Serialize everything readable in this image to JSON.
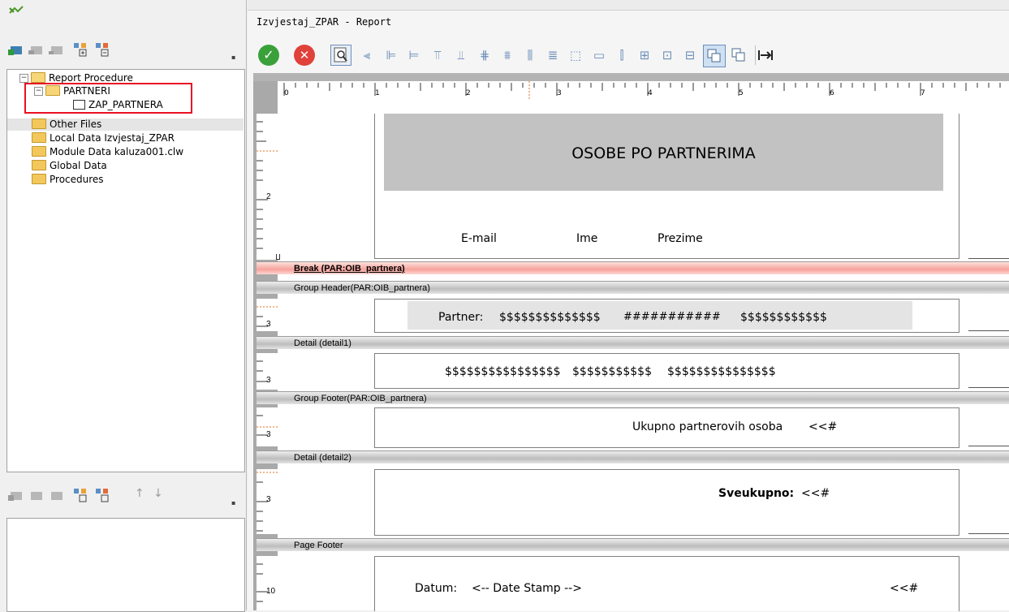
{
  "left": {
    "tree": [
      {
        "label": "Report Procedure"
      },
      {
        "label": "PARTNERI"
      },
      {
        "label": "ZAP_PARTNERA"
      },
      {
        "label": "Other Files"
      },
      {
        "label": "Local Data Izvjestaj_ZPAR"
      },
      {
        "label": "Module Data kaluza001.clw"
      },
      {
        "label": "Global Data"
      },
      {
        "label": "Procedures"
      }
    ],
    "highlight_color": "#e81123"
  },
  "window": {
    "title": "Izvjestaj_ZPAR - Report"
  },
  "ruler": {
    "labels": [
      "0",
      "1",
      "2",
      "3",
      "4",
      "5",
      "6",
      "7"
    ]
  },
  "vruler": {
    "labels": [
      "2",
      "3",
      "3",
      "3",
      "3",
      "10"
    ]
  },
  "report": {
    "title": "OSOBE PO PARTNERIMA",
    "col_email": "E-mail",
    "col_ime": "Ime",
    "col_prezime": "Prezime",
    "break_band": "Break (PAR:OIB_partnera)",
    "group_header_band": "Group Header(PAR:OIB_partnera)",
    "partner_label": "Partner:",
    "partner_field1": "$$$$$$$$$$$$$$",
    "partner_field2": "###########",
    "partner_field3": "$$$$$$$$$$$$",
    "detail1_band": "Detail (detail1)",
    "detail1_f1": "$$$$$$$$$$$$$$$$",
    "detail1_f2": "$$$$$$$$$$$",
    "detail1_f3": "$$$$$$$$$$$$$$$",
    "group_footer_band": "Group Footer(PAR:OIB_partnera)",
    "ukupno_label": "Ukupno partnerovih osoba",
    "ukupno_value": "<<#",
    "detail2_band": "Detail (detail2)",
    "sveukupno_label": "Sveukupno:",
    "sveukupno_value": "<<#",
    "page_footer_band": "Page Footer",
    "datum_label": "Datum:",
    "date_stamp": "<-- Date Stamp -->",
    "footer_value": "<<#"
  },
  "colors": {
    "accept": "#3aa13a",
    "cancel": "#e0413a",
    "break_band": "#f6a39b"
  }
}
